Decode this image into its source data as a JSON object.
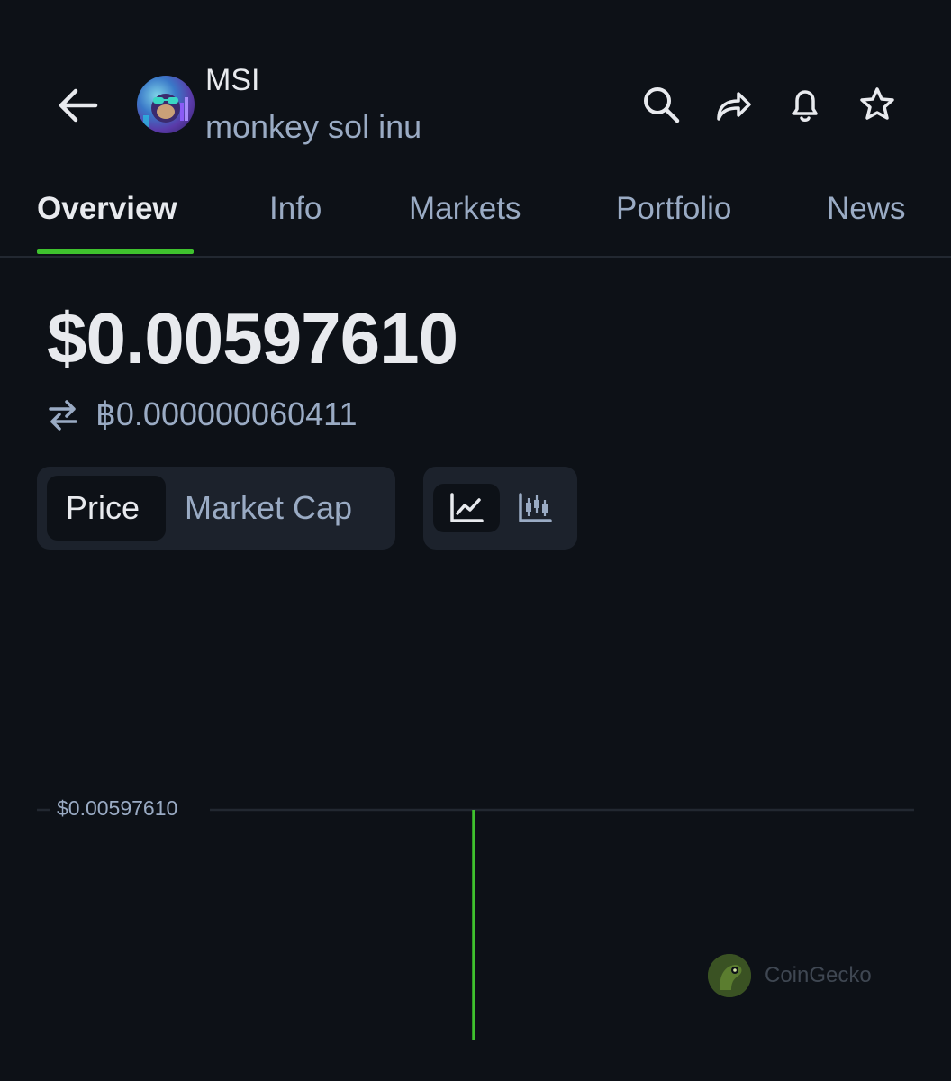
{
  "header": {
    "symbol": "MSI",
    "name": "monkey sol inu",
    "back_icon": "arrow-left-icon",
    "actions": [
      "search-icon",
      "share-icon",
      "bell-icon",
      "star-icon"
    ]
  },
  "tabs": [
    {
      "label": "Overview",
      "active": true
    },
    {
      "label": "Info",
      "active": false
    },
    {
      "label": "Markets",
      "active": false
    },
    {
      "label": "Portfolio",
      "active": false
    },
    {
      "label": "News",
      "active": false
    }
  ],
  "price": {
    "usd": "$0.00597610",
    "btc": "฿0.000000060411",
    "convert_icon": "swap-arrows-icon"
  },
  "toggles": {
    "metric": {
      "options": [
        "Price",
        "Market Cap"
      ],
      "selected": "Price"
    },
    "chart_style": {
      "options": [
        "line-chart-icon",
        "candlestick-icon"
      ],
      "selected": "line-chart-icon"
    }
  },
  "chart_data": {
    "type": "line",
    "price_label": "$0.00597610",
    "values": [
      0.0059761
    ],
    "line_color": "#3fc22e"
  },
  "watermark": {
    "text": "CoinGecko",
    "logo_icon": "coingecko-logo-icon"
  },
  "colors": {
    "background": "#0d1117",
    "accent": "#3fc22e",
    "muted_text": "#9aabc4",
    "control_bg": "#1c222c"
  }
}
